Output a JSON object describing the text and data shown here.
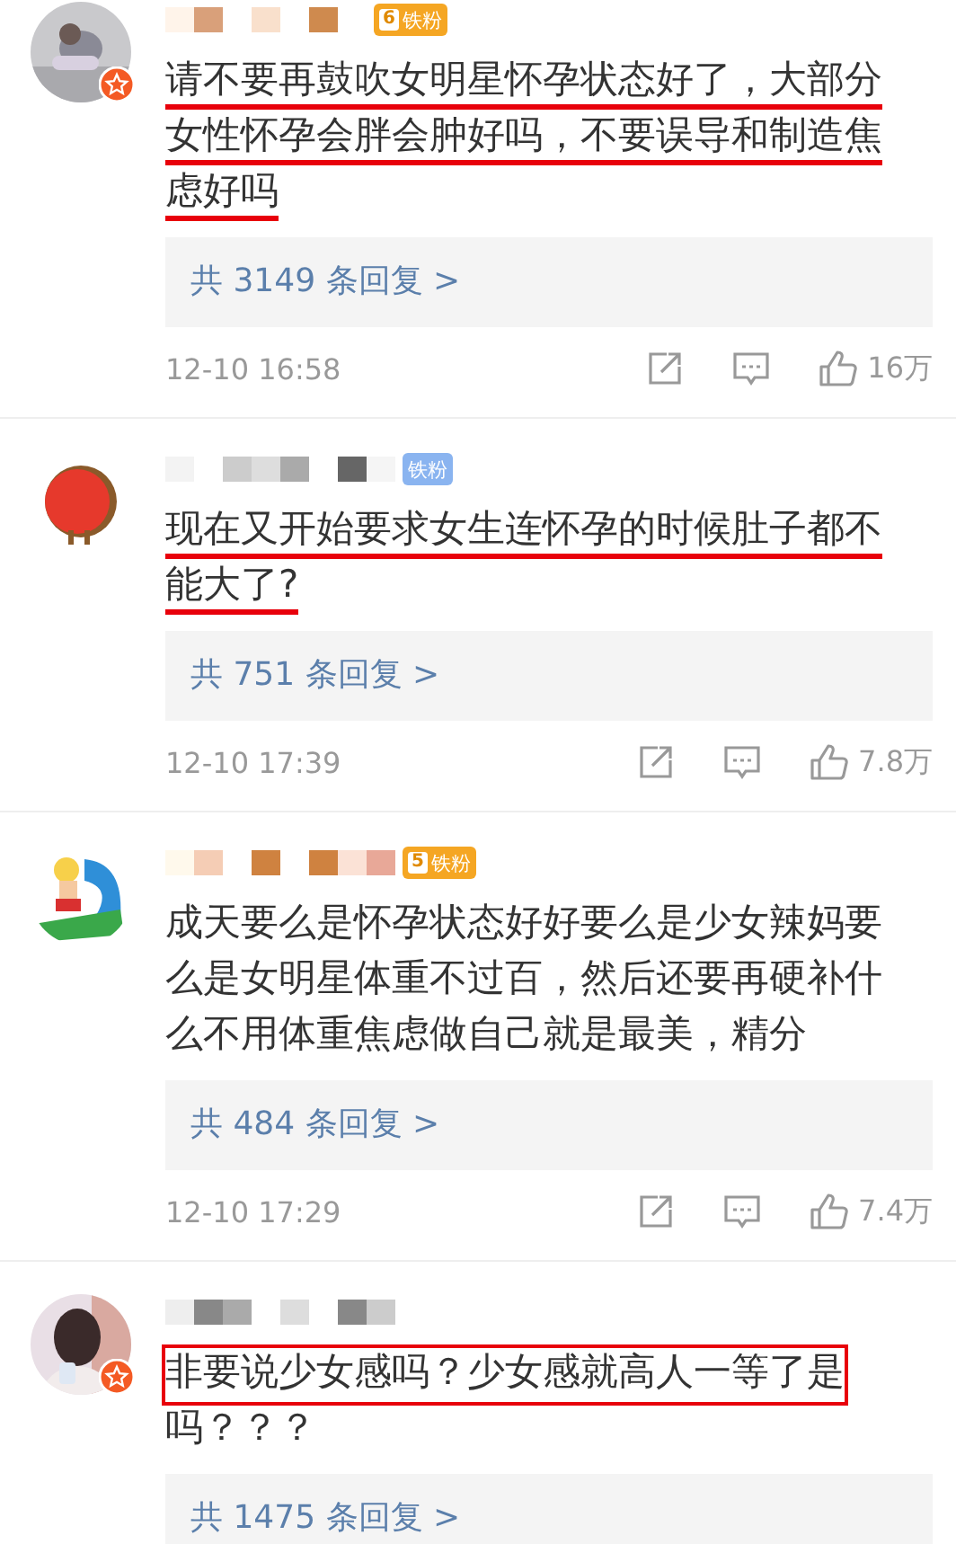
{
  "comments": [
    {
      "avatar": {
        "kind": "gray",
        "star": true
      },
      "badge": {
        "label": "铁粉",
        "level": "6",
        "color": "#f5a623"
      },
      "lines": [
        {
          "text": "请不要再鼓吹女明星怀孕状态好了，大部分",
          "underlined": true,
          "boxed": false
        },
        {
          "text": "女性怀孕会胖会肿好吗，不要误导和制造焦",
          "underlined": true,
          "boxed": false
        },
        {
          "text": "虑好吗",
          "underlined": true,
          "boxed": false
        }
      ],
      "replies": "共 3149 条回复 >",
      "time": "12-10 16:58",
      "likes": "16万"
    },
    {
      "avatar": {
        "kind": "red",
        "star": false
      },
      "badge": {
        "label": "铁粉",
        "color": "#8ab4f0"
      },
      "lines": [
        {
          "text": "现在又开始要求女生连怀孕的时候肚子都不",
          "underlined": true,
          "boxed": false
        },
        {
          "text": "能大了?",
          "underlined": true,
          "boxed": false
        }
      ],
      "replies": "共 751 条回复 >",
      "time": "12-10 17:39",
      "likes": "7.8万"
    },
    {
      "avatar": {
        "kind": "blue",
        "star": false
      },
      "badge": {
        "label": "铁粉",
        "level": "5",
        "color": "#f5a623"
      },
      "lines": [
        {
          "text": "成天要么是怀孕状态好好要么是少女辣妈要",
          "underlined": false,
          "boxed": false
        },
        {
          "text": "么是女明星体重不过百，然后还要再硬补什",
          "underlined": false,
          "boxed": false
        },
        {
          "text": "么不用体重焦虑做自己就是最美，精分",
          "underlined": false,
          "boxed": false
        }
      ],
      "replies": "共 484 条回复 >",
      "time": "12-10 17:29",
      "likes": "7.4万"
    },
    {
      "avatar": {
        "kind": "pink",
        "star": true
      },
      "lines": [
        {
          "text": "非要说少女感吗？少女感就高人一等了是",
          "underlined": false,
          "boxed": true
        },
        {
          "text": "吗？？？",
          "underlined": false,
          "boxed": false
        }
      ],
      "replies": "共 1475 条回复 >"
    }
  ]
}
